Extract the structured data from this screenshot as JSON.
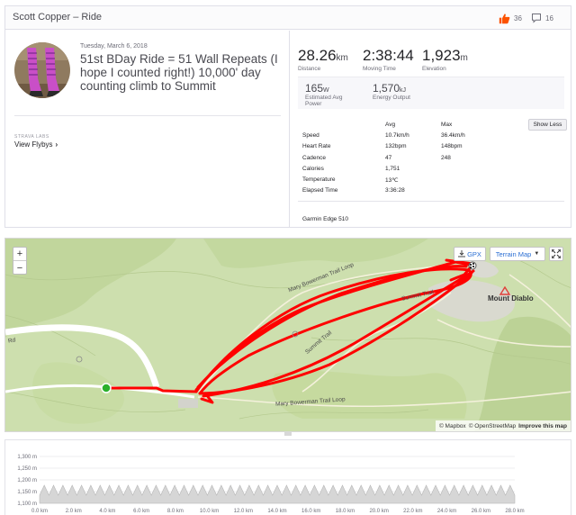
{
  "header": {
    "title": "Scott Copper – Ride",
    "kudos_count": "36",
    "comment_count": "16"
  },
  "activity": {
    "date": "Tuesday, March 6, 2018",
    "name": "51st BDay Ride = 51 Wall Repeats (I hope I counted right!) 10,000' day counting climb to Summit",
    "labs_label": "STRAVA LABS",
    "flybys_label": "View Flybys"
  },
  "stats": {
    "distance": {
      "value": "28.26",
      "unit": "km",
      "label": "Distance"
    },
    "moving_time": {
      "value": "2:38:44",
      "unit": "",
      "label": "Moving Time"
    },
    "elevation": {
      "value": "1,923",
      "unit": "m",
      "label": "Elevation"
    },
    "power": {
      "value": "165",
      "unit": "W",
      "label": "Estimated Avg Power"
    },
    "energy": {
      "value": "1,570",
      "unit": "kJ",
      "label": "Energy Output"
    }
  },
  "details_table": {
    "col_avg": "Avg",
    "col_max": "Max",
    "show_less": "Show Less",
    "rows": [
      {
        "label": "Speed",
        "avg": "10.7km/h",
        "max": "36.4km/h"
      },
      {
        "label": "Heart Rate",
        "avg": "132bpm",
        "max": "148bpm"
      },
      {
        "label": "Cadence",
        "avg": "47",
        "max": "248"
      },
      {
        "label": "Calories",
        "avg": "1,751",
        "max": ""
      },
      {
        "label": "Temperature",
        "avg": "13℃",
        "max": ""
      },
      {
        "label": "Elapsed Time",
        "avg": "3:36:28",
        "max": ""
      }
    ],
    "device": "Garmin Edge 510"
  },
  "map": {
    "zoom_in": "+",
    "zoom_out": "−",
    "gpx_label": "GPX",
    "terrain_label": "Terrain Map",
    "trail_labels": [
      "Mary Bowerman Trail Loop",
      "Mary Bowerman Trail Loop",
      "Summit Trail",
      "Summit Trail",
      "Rd"
    ],
    "place_label": "Mount Diablo",
    "attribution_mapbox": "© Mapbox",
    "attribution_osm": "© OpenStreetMap",
    "attribution_improve": "Improve this map",
    "route_color": "#ff0000",
    "start_color": "#2bb02b"
  },
  "elevation_chart": {
    "y_ticks": [
      "1,300 m",
      "1,250 m",
      "1,200 m",
      "1,150 m",
      "1,100 m"
    ],
    "x_ticks": [
      "0.0 km",
      "2.0 km",
      "4.0 km",
      "6.0 km",
      "8.0 km",
      "10.0 km",
      "12.0 km",
      "14.0 km",
      "16.0 km",
      "18.0 km",
      "20.0 km",
      "22.0 km",
      "24.0 km",
      "26.0 km",
      "28.0 km"
    ]
  }
}
